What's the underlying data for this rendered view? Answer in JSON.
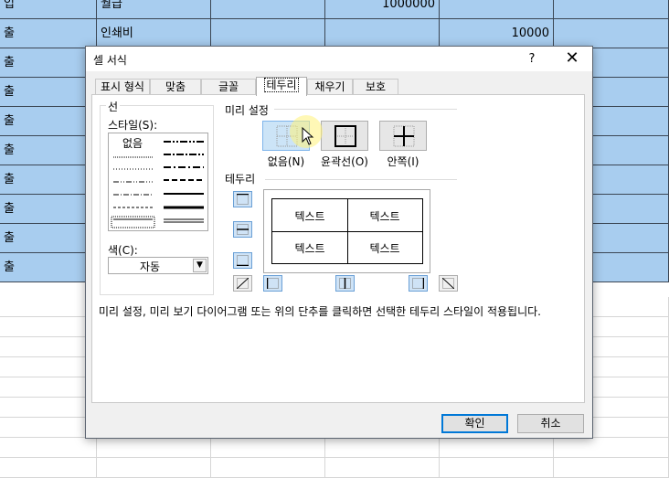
{
  "sheet": {
    "rows": [
      {
        "c0": "입",
        "c1": "월급",
        "c3": "1000000",
        "c4": ""
      },
      {
        "c0": "출",
        "c1": "인쇄비",
        "c3": "",
        "c4": "10000"
      },
      {
        "c0": "출",
        "c1": "",
        "c3": "",
        "c4": ""
      },
      {
        "c0": "출",
        "c1": "",
        "c3": "",
        "c4": ""
      },
      {
        "c0": "출",
        "c1": "",
        "c3": "",
        "c4": ""
      },
      {
        "c0": "출",
        "c1": "",
        "c3": "",
        "c4": ""
      },
      {
        "c0": "출",
        "c1": "",
        "c3": "",
        "c4": ""
      },
      {
        "c0": "출",
        "c1": "",
        "c3": "",
        "c4": ""
      },
      {
        "c0": "출",
        "c1": "",
        "c3": "",
        "c4": ""
      },
      {
        "c0": "출",
        "c1": "",
        "c3": "",
        "c4": ""
      }
    ],
    "selection_color": "#a8cdef"
  },
  "dialog": {
    "title": "셀 서식",
    "help": "?",
    "close": "✕",
    "tabs": [
      "표시 형식",
      "맞춤",
      "글꼴",
      "테두리",
      "채우기",
      "보호"
    ],
    "active_tab": "테두리",
    "line": {
      "title": "선",
      "style_label": "스타일(S):",
      "style_none": "없음",
      "color_label": "색(C):",
      "color_value": "자동"
    },
    "presets": {
      "title": "미리 설정",
      "none": "없음(N)",
      "outline": "윤곽선(O)",
      "inside": "안쪽(I)"
    },
    "border": {
      "title": "테두리",
      "preview_text": [
        "텍스트",
        "텍스트",
        "텍스트",
        "텍스트"
      ]
    },
    "help_text": "미리 설정, 미리 보기 다이어그램 또는 위의 단추를 클릭하면 선택한 테두리 스타일이 적용됩니다.",
    "ok": "확인",
    "cancel": "취소"
  }
}
